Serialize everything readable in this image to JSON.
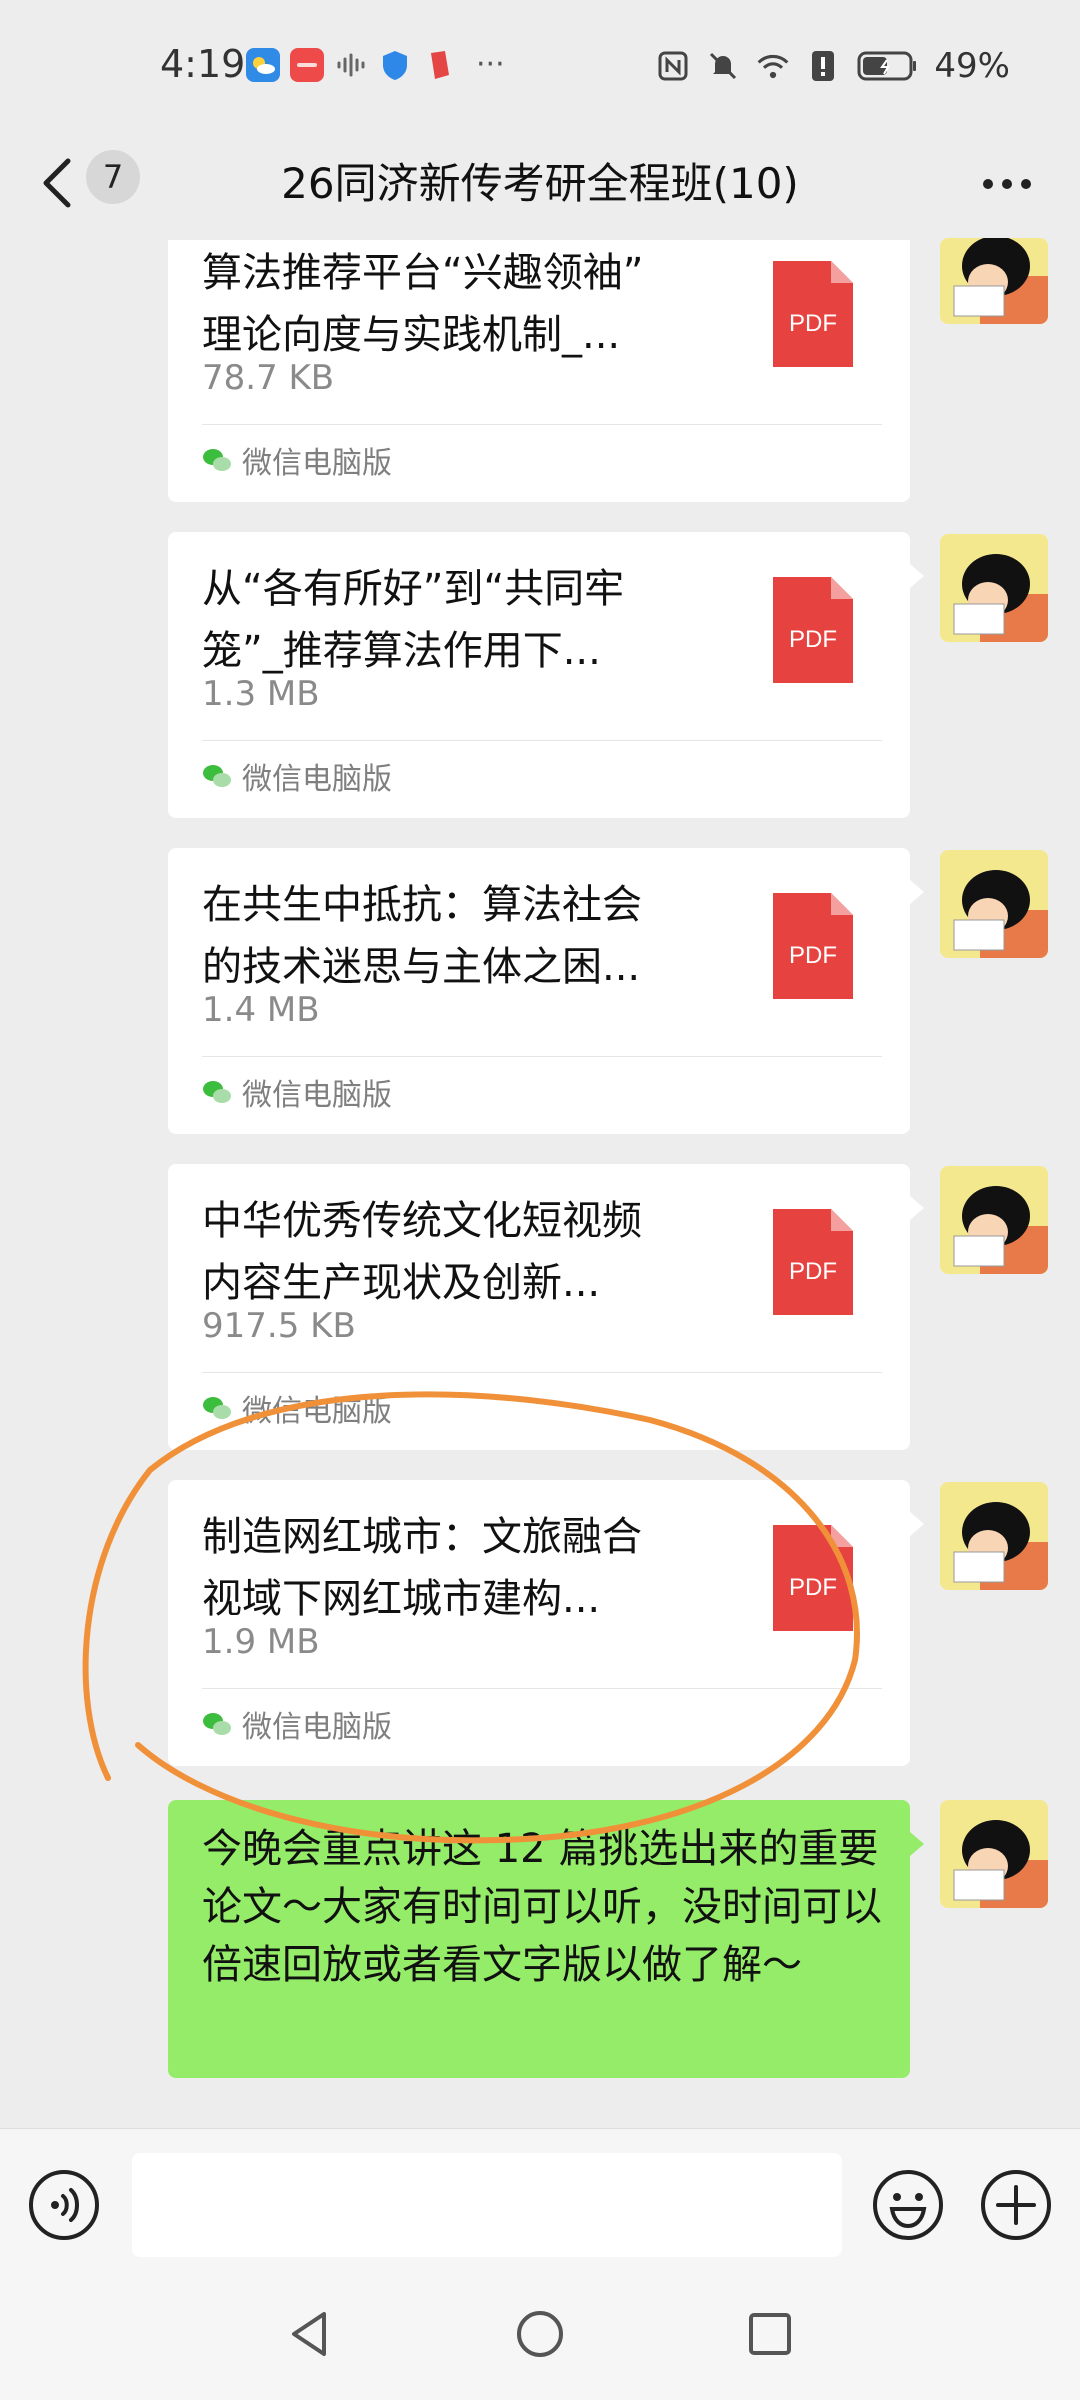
{
  "status_bar": {
    "time": "4:19",
    "battery": "49%",
    "notification_icons": [
      "weather-icon",
      "huawei-app-icon",
      "audio-wave-icon",
      "shield-icon",
      "app-icon"
    ],
    "overflow": "···"
  },
  "header": {
    "unread_count": "7",
    "title": "26同济新传考研全程班(10)"
  },
  "messages": [
    {
      "type": "file",
      "name_line1": "算法推荐平台“兴趣领袖”",
      "name_line2": "理论向度与实践机制_...",
      "size": "78.7 KB",
      "file_type": "PDF",
      "source": "微信电脑版"
    },
    {
      "type": "file",
      "name_line1": "从“各有所好”到“共同牢",
      "name_line2": "笼”_推荐算法作用下...",
      "size": "1.3 MB",
      "file_type": "PDF",
      "source": "微信电脑版"
    },
    {
      "type": "file",
      "name_line1": "在共生中抵抗：算法社会",
      "name_line2": "的技术迷思与主体之困...",
      "size": "1.4 MB",
      "file_type": "PDF",
      "source": "微信电脑版"
    },
    {
      "type": "file",
      "name_line1": "中华优秀传统文化短视频",
      "name_line2": "内容生产现状及创新...",
      "size": "917.5 KB",
      "file_type": "PDF",
      "source": "微信电脑版"
    },
    {
      "type": "file",
      "name_line1": "制造网红城市：文旅融合",
      "name_line2": "视域下网红城市建构...",
      "size": "1.9 MB",
      "file_type": "PDF",
      "source": "微信电脑版"
    },
    {
      "type": "text",
      "text": "今晚会重点讲这 12 篇挑选出来的重要论文～大家有时间可以听，没时间可以倍速回放或者看文字版以做了解～"
    }
  ],
  "colors": {
    "bubble_green": "#95ec69",
    "pdf_red": "#e64340",
    "annotation_orange": "#f0913a"
  },
  "input": {
    "placeholder": ""
  }
}
